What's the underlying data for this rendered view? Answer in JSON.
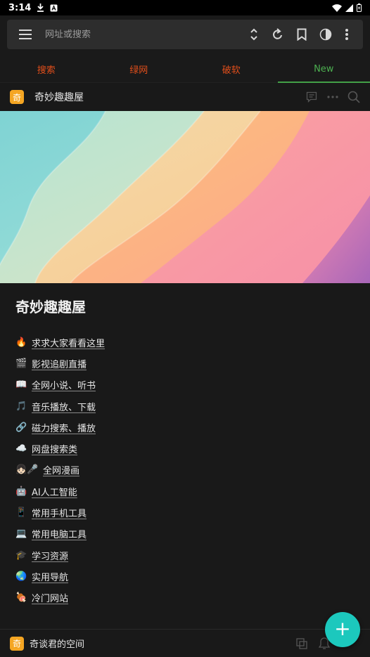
{
  "status_bar": {
    "time": "3:14"
  },
  "browser": {
    "url_placeholder": "网址或搜索"
  },
  "bookmark_tabs": [
    {
      "label": "搜索",
      "active": false
    },
    {
      "label": "绿网",
      "active": false
    },
    {
      "label": "破软",
      "active": false
    },
    {
      "label": "New",
      "active": true
    }
  ],
  "page_header": {
    "logo_char": "奇",
    "site_name": "奇妙趣趣屋"
  },
  "content": {
    "title": "奇妙趣趣屋",
    "links": [
      {
        "emoji": "🔥",
        "label": "求求大家看看这里"
      },
      {
        "emoji": "🎬",
        "label": "影视追剧直播"
      },
      {
        "emoji": "📖",
        "label": "全网小说、听书"
      },
      {
        "emoji": "🎵",
        "label": "音乐播放、下载"
      },
      {
        "emoji": "🔗",
        "label": "磁力搜索、播放"
      },
      {
        "emoji": "☁️",
        "label": "网盘搜索类"
      },
      {
        "emoji": "👧🏻🎤",
        "label": "全网漫画"
      },
      {
        "emoji": "🤖",
        "label": "AI人工智能"
      },
      {
        "emoji": "📱",
        "label": "常用手机工具"
      },
      {
        "emoji": "💻",
        "label": "常用电脑工具"
      },
      {
        "emoji": "🎓",
        "label": "学习资源"
      },
      {
        "emoji": "🌏",
        "label": "实用导航"
      },
      {
        "emoji": "🍖",
        "label": "冷门网站"
      }
    ]
  },
  "bottom_bar": {
    "logo_char": "奇",
    "space_name": "奇谈君的空间"
  },
  "fab": {
    "icon": "+"
  },
  "colors": {
    "tab_inactive": "#e04e1b",
    "tab_active": "#4caf50",
    "fab": "#1cc8bd",
    "logo": "#f5a623"
  }
}
